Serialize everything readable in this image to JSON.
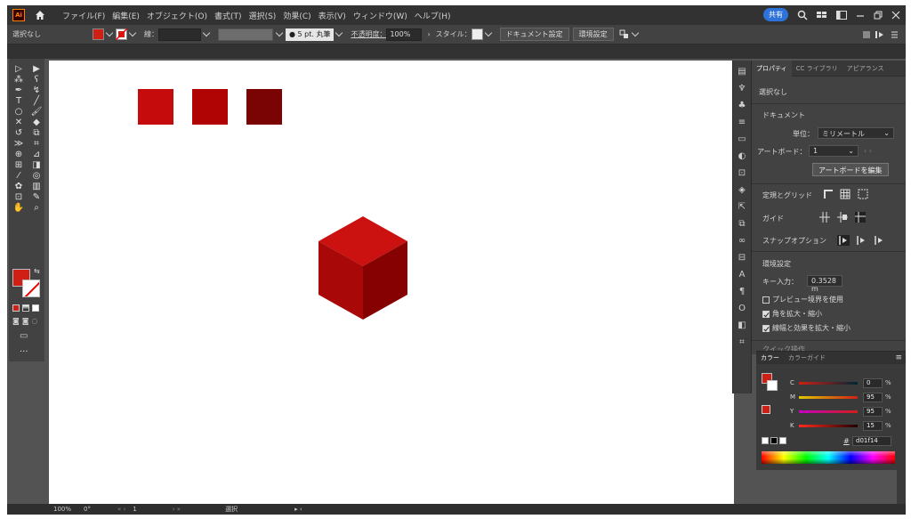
{
  "app": {
    "logo": "Ai"
  },
  "menu": {
    "items": [
      "ファイル(F)",
      "編集(E)",
      "オブジェクト(O)",
      "書式(T)",
      "選択(S)",
      "効果(C)",
      "表示(V)",
      "ウィンドウ(W)",
      "ヘルプ(H)"
    ],
    "share_label": "共有"
  },
  "control_bar": {
    "selection_label": "選択なし",
    "stroke_label": "線：",
    "brush_label": "● 5 pt. 丸筆",
    "opacity_label": "不透明度：",
    "opacity_value": "100%",
    "style_label": "スタイル：",
    "doc_settings_button": "ドキュメント設定",
    "preferences_button": "環境設定"
  },
  "status_bar": {
    "zoom": "100%",
    "rotation": "0°",
    "artboard_number": "1",
    "mode": "選択"
  },
  "properties_panel": {
    "tabs": [
      "プロパティ",
      "CC ライブラリ",
      "アピアランス"
    ],
    "selection": "選択なし",
    "document_header": "ドキュメント",
    "units_label": "単位：",
    "units_value": "ミリメートル",
    "artboard_label": "アートボード：",
    "artboard_value": "1",
    "edit_artboard_button": "アートボードを編集",
    "ruler_grid_label": "定規とグリッド",
    "guides_label": "ガイド",
    "snap_options_label": "スナップオプション",
    "preferences_header": "環境設定",
    "key_increment_label": "キー入力：",
    "key_increment_value": "0.3528 m",
    "preview_bounds_label": "プレビュー境界を使用",
    "scale_corners_label": "角を拡大・縮小",
    "scale_strokes_label": "線幅と効果を拡大・縮小",
    "quick_actions_label": "クイック操作"
  },
  "color_panel": {
    "tabs": [
      "カラー",
      "カラーガイド"
    ],
    "channels": [
      {
        "label": "C",
        "value": "0",
        "unit": "%"
      },
      {
        "label": "M",
        "value": "95",
        "unit": "%"
      },
      {
        "label": "Y",
        "value": "95",
        "unit": "%"
      },
      {
        "label": "K",
        "value": "15",
        "unit": "%"
      }
    ],
    "hex_label": "#",
    "hex_value": "d01f14"
  },
  "colors": {
    "fill": "#d01f14",
    "square_1": "#c50b0b",
    "square_2": "#b00404",
    "square_3": "#7a0303",
    "cube_top": "#cc1111",
    "cube_left": "#a80808",
    "cube_right": "#860202"
  },
  "icons": [
    "home-icon",
    "search-icon",
    "selection-tool-icon",
    "direct-selection-tool-icon",
    "pen-tool-icon",
    "type-tool-icon",
    "hand-tool-icon",
    "zoom-tool-icon"
  ]
}
